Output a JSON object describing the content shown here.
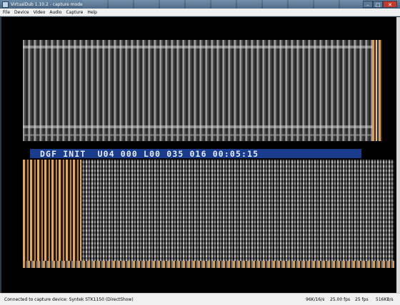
{
  "window": {
    "title": "VirtualDub 1.10.2 - capture mode",
    "minimize": "–",
    "maximize": "□",
    "close": "✕"
  },
  "menu": [
    "File",
    "Device",
    "Video",
    "Audio",
    "Capture",
    "Help"
  ],
  "osd": {
    "text": "DGF INIT  U04 000 L00 035 016 00:05:15"
  },
  "status": {
    "message": "Connected to capture device: Syntek STK1150 (DirectShow)",
    "audio_rate": "96K/16/s",
    "target_fps": "25.00 fps",
    "actual_fps": "25 fps",
    "data_rate": "516KB/s"
  },
  "colors": {
    "osd_background": "#1a3c8c",
    "osd_text": "#e6ecf8",
    "video_accent": "#d8a060"
  }
}
